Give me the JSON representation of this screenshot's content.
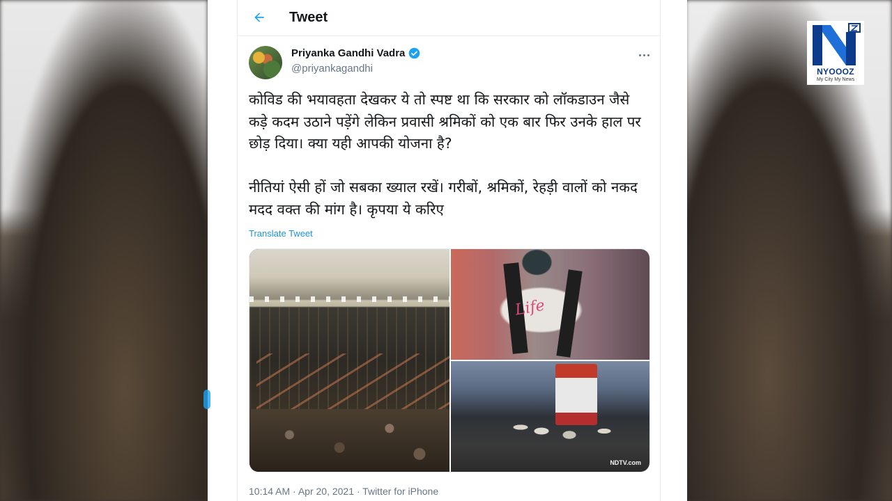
{
  "header": {
    "title": "Tweet",
    "back_icon": "arrow-left-icon"
  },
  "author": {
    "name": "Priyanka Gandhi Vadra",
    "handle": "@priyankagandhi",
    "verified": true
  },
  "tweet": {
    "paragraph1": "कोविड की भयावहता देखकर ये तो स्पष्ट था कि सरकार को लॉकडाउन जैसे कड़े कदम उठाने पड़ेंगे लेकिन प्रवासी श्रमिकों को एक बार फिर उनके हाल पर छोड़ दिया। क्या यही आपकी योजना है?",
    "paragraph2": "नीतियां ऐसी हों जो सबका ख्याल रखें। गरीबों, श्रमिकों, रेहड़ी वालों को नकद मदद वक्त की मांग है। कृपया ये करिए",
    "translate_label": "Translate Tweet",
    "photo2_text": "Life",
    "photo3_watermark": "NDTV.com"
  },
  "meta": {
    "timestamp": "10:14 AM · Apr 20, 2021 · Twitter for iPhone"
  },
  "logo": {
    "brand": "NYOOOZ",
    "tagline": "My City My News"
  },
  "colors": {
    "accent": "#1da1f2",
    "text_primary": "#14171a",
    "text_secondary": "#657786",
    "link": "#1b95e0",
    "logo_blue": "#0b3b8a"
  }
}
